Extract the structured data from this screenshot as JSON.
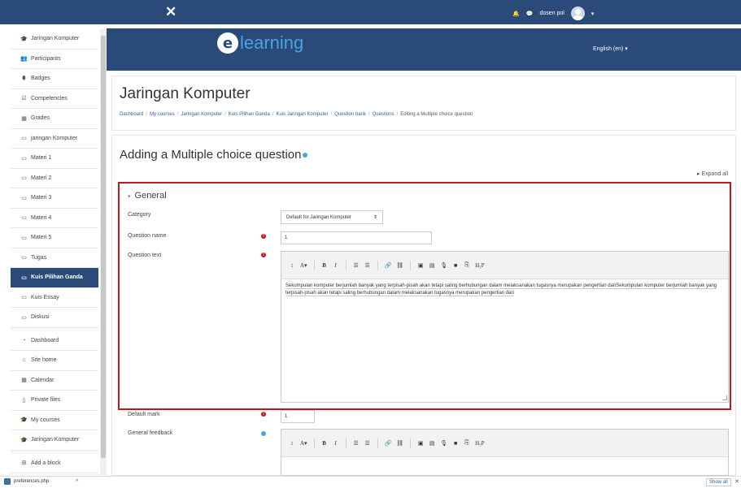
{
  "topbar": {
    "close_glyph": "✕",
    "bell_icon": "bell-icon",
    "chat_icon": "chat-icon",
    "user_name": "dosen pol",
    "caret": "▾"
  },
  "sidebar": {
    "items": [
      {
        "icon": "graduation-cap-icon",
        "glyph": "🎓",
        "label": "Jaringan Komputer"
      },
      {
        "icon": "users-icon",
        "glyph": "👥",
        "label": "Participants"
      },
      {
        "icon": "badge-icon",
        "glyph": "⬮",
        "label": "Badges"
      },
      {
        "icon": "checklist-icon",
        "glyph": "☑",
        "label": "Competencies"
      },
      {
        "icon": "table-icon",
        "glyph": "▦",
        "label": "Grades"
      },
      {
        "icon": "folder-icon",
        "glyph": "▭",
        "label": "jaringan Komputer"
      },
      {
        "icon": "folder-icon",
        "glyph": "▭",
        "label": "Materi 1"
      },
      {
        "icon": "folder-icon",
        "glyph": "▭",
        "label": "Materi 2"
      },
      {
        "icon": "folder-icon",
        "glyph": "▭",
        "label": "Materi 3"
      },
      {
        "icon": "folder-icon",
        "glyph": "▭",
        "label": "Materi 4"
      },
      {
        "icon": "folder-icon",
        "glyph": "▭",
        "label": "Materi 5"
      },
      {
        "icon": "folder-icon",
        "glyph": "▭",
        "label": "Tugas"
      },
      {
        "icon": "folder-icon",
        "glyph": "▭",
        "label": "Kuis Pilihan Ganda"
      },
      {
        "icon": "folder-icon",
        "glyph": "▭",
        "label": "Kuis Essay"
      },
      {
        "icon": "folder-icon",
        "glyph": "▭",
        "label": "Diskusi"
      },
      {
        "icon": "dashboard-icon",
        "glyph": "◔",
        "label": "Dashboard"
      },
      {
        "icon": "home-icon",
        "glyph": "⌂",
        "label": "Site home"
      },
      {
        "icon": "calendar-icon",
        "glyph": "▦",
        "label": "Calendar"
      },
      {
        "icon": "file-icon",
        "glyph": "▯",
        "label": "Private files"
      },
      {
        "icon": "graduation-cap-icon",
        "glyph": "🎓",
        "label": "My courses"
      },
      {
        "icon": "graduation-cap-icon",
        "glyph": "🎓",
        "label": "Jaringan Komputer"
      },
      {
        "icon": "plus-square-icon",
        "glyph": "⊞",
        "label": "Add a block"
      }
    ]
  },
  "header": {
    "logo_letter": "e",
    "logo_word": "learning",
    "language": "English (en) ▾"
  },
  "page": {
    "title": "Jaringan Komputer",
    "breadcrumb": [
      "Dashboard",
      "My courses",
      "Jaringan Komputer",
      "Kuis Pilihan Ganda",
      "Kuis Jaringan Komputer",
      "Question bank",
      "Questions",
      "Editing a Multiple choice question"
    ]
  },
  "form": {
    "title": "Adding a Multiple choice question",
    "expand_all": "Expand all",
    "section": "General",
    "category_label": "Category",
    "category_value": "Default for Jaringan Komputer",
    "question_name_label": "Question name",
    "question_name_value": "1",
    "question_text_label": "Question text",
    "question_text_value": "Sekumpulan komputer berjumlah banyak yang terpisah-pisah akan tetapi saling berhubungan dalam melaksanakan tugasnya merupakan pengertian dariSekumpulan komputer berjumlah banyak yang terpisah-pisah akan tetapi saling berhubungan dalam melaksanakan tugasnya merupakan pengertian dari",
    "default_mark_label": "Default mark",
    "default_mark_value": "1",
    "general_feedback_label": "General feedback",
    "toolbar": [
      "↕",
      "A▾",
      "B",
      "I",
      "☰",
      "☰",
      "🔗",
      "⛓",
      "▣",
      "▤",
      "🎙",
      "■",
      "⎘",
      "H₅P"
    ]
  },
  "bottombar": {
    "file_name": "preferences.php",
    "chevron": "^",
    "show_all": "Show all",
    "close": "✕"
  },
  "colors": {
    "brand": "#2a4a7a",
    "accent": "#4aa3df",
    "required": "#c4161c"
  }
}
